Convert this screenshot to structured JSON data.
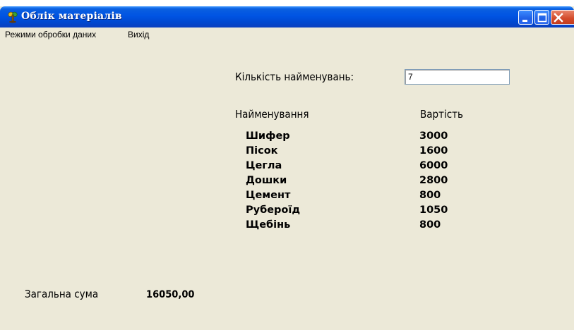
{
  "window": {
    "title": "Облік матеріалів"
  },
  "menu": {
    "items": [
      "Режими обробки даних",
      "Вихід"
    ]
  },
  "count": {
    "label": "Кількість найменувань:",
    "value": "7"
  },
  "table": {
    "headers": [
      "Найменування",
      "Вартість"
    ],
    "names": [
      "Шифер",
      "Пісок",
      "Цегла",
      "Дошки",
      "Цемент",
      "Руберoїд",
      "Щебінь"
    ],
    "costs": [
      "3000",
      "1600",
      "6000",
      "2800",
      "800",
      "1050",
      "800"
    ]
  },
  "total": {
    "label": "Загальна сума",
    "value": "16050,00"
  },
  "colors": {
    "window_bg": "#ece9d8",
    "titlebar": "#0054e3",
    "close_button": "#d34a2a"
  }
}
